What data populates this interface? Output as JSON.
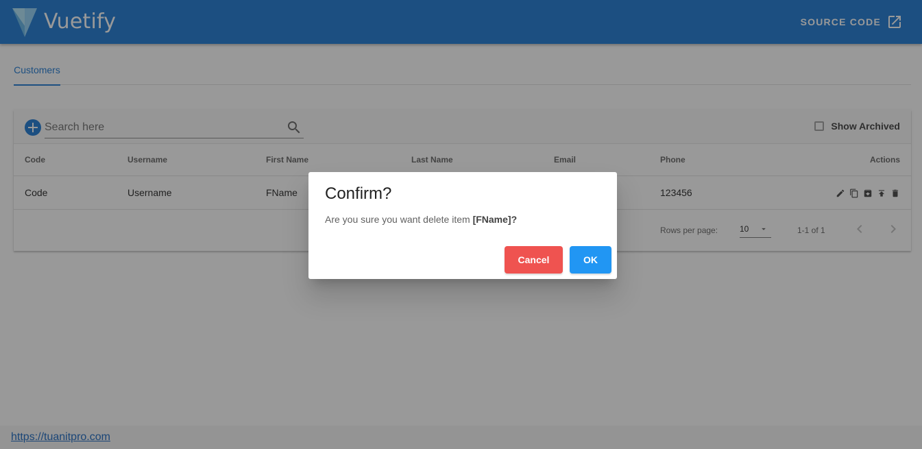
{
  "header": {
    "brand": "Vuetify",
    "source_label": "SOURCE CODE",
    "bg_color": "#1976d2"
  },
  "tabs": [
    {
      "label": "Customers",
      "active": true
    }
  ],
  "toolbar": {
    "add_icon": "plus-circle-icon",
    "search_placeholder": "Search here",
    "search_value": "",
    "archived_label": "Show Archived",
    "archived_checked": false
  },
  "table": {
    "headers": [
      "Code",
      "Username",
      "First Name",
      "Last Name",
      "Email",
      "Phone",
      "Actions"
    ],
    "rows": [
      {
        "code": "Code",
        "username": "Username",
        "first_name": "FName",
        "last_name": "",
        "email": "",
        "phone": "123456",
        "actions": [
          "edit-icon",
          "copy-icon",
          "archive-icon",
          "publish-icon",
          "delete-icon"
        ]
      }
    ]
  },
  "pagination": {
    "rows_per_page_label": "Rows per page:",
    "rows_per_page": "10",
    "range": "1-1 of 1"
  },
  "footer": {
    "link": "https://tuanitpro.com"
  },
  "dialog": {
    "title": "Confirm?",
    "message_prefix": "Are you sure you want delete item ",
    "message_item": "[FName]?",
    "cancel_label": "Cancel",
    "ok_label": "OK",
    "cancel_color": "#ef5350",
    "ok_color": "#2196f3"
  }
}
